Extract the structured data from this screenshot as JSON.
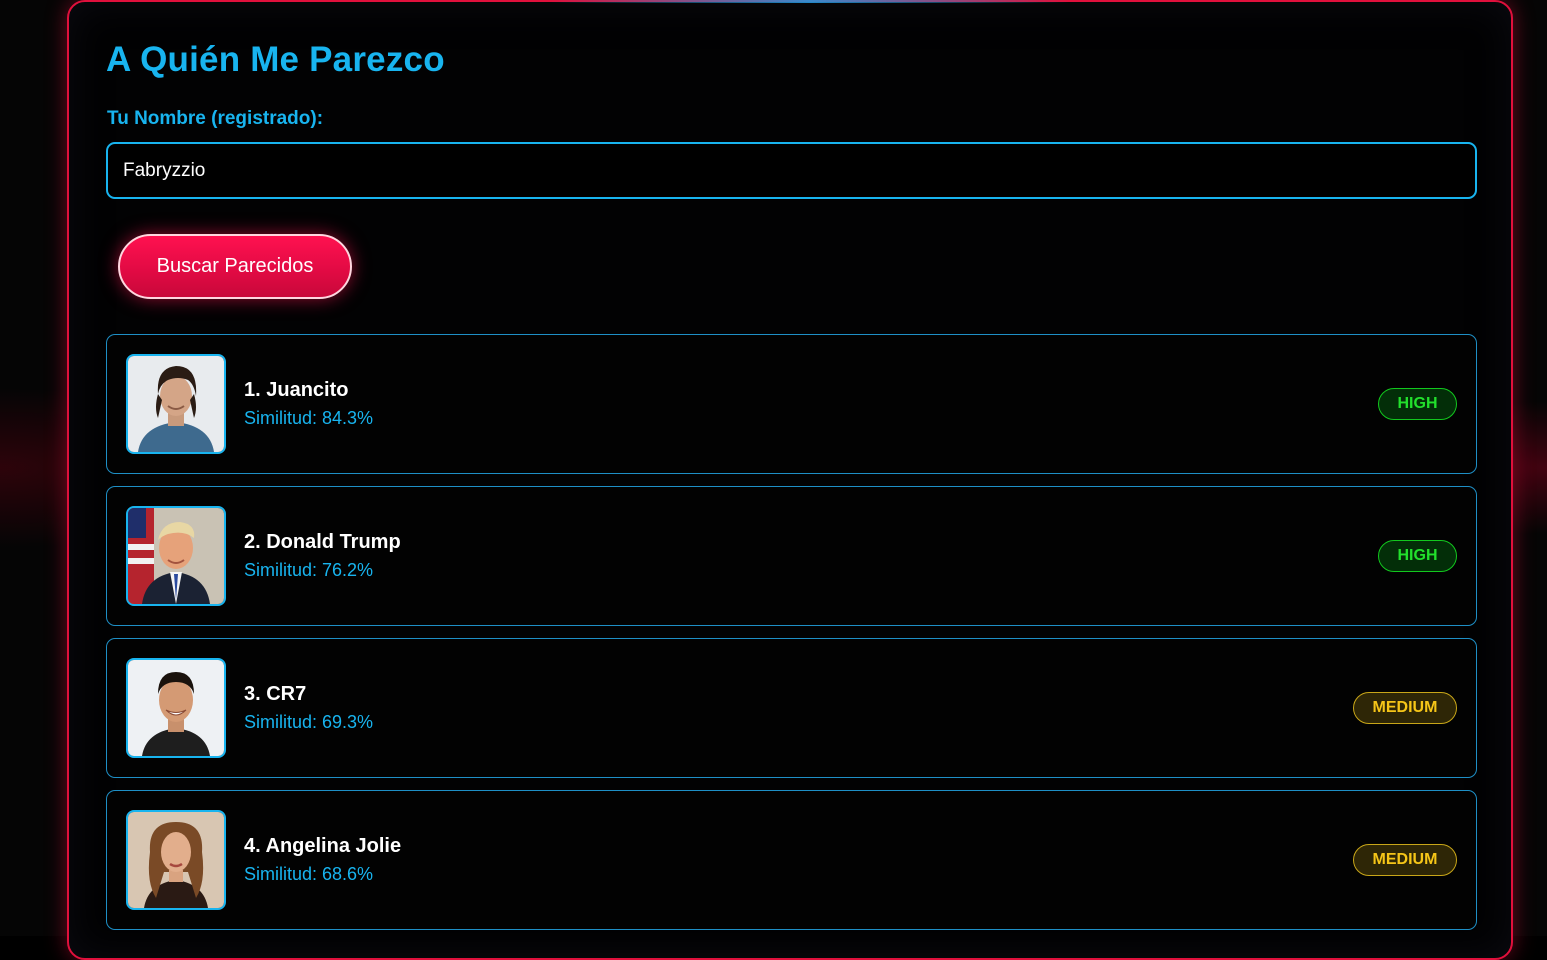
{
  "header": {
    "title": "A Quién Me Parezco"
  },
  "form": {
    "name_label": "Tu Nombre (registrado):",
    "name_value": "Fabryzzio",
    "search_button": "Buscar Parecidos"
  },
  "results": [
    {
      "name": "1. Juancito",
      "similarity": "Similitud: 84.3%",
      "level": "HIGH",
      "avatar_icon": "person-photo-icon"
    },
    {
      "name": "2. Donald Trump",
      "similarity": "Similitud: 76.2%",
      "level": "HIGH",
      "avatar_icon": "person-photo-icon"
    },
    {
      "name": "3. CR7",
      "similarity": "Similitud: 69.3%",
      "level": "MEDIUM",
      "avatar_icon": "person-photo-icon"
    },
    {
      "name": "4. Angelina Jolie",
      "similarity": "Similitud: 68.6%",
      "level": "MEDIUM",
      "avatar_icon": "person-photo-icon"
    }
  ],
  "colors": {
    "accent": "#18b4ef",
    "brand_red": "#e0103c",
    "high": "#22e02c",
    "medium": "#f5c518"
  }
}
